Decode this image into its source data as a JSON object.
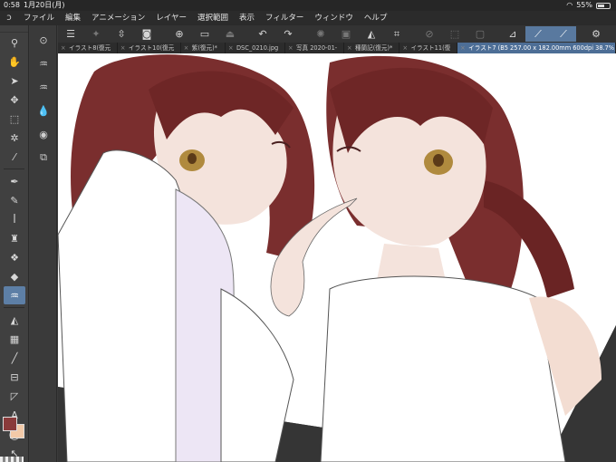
{
  "status": {
    "time": "0:58",
    "date": "1月20日(月)",
    "battery": "55%",
    "battery_level": 0.55
  },
  "menu": [
    "ファイル",
    "編集",
    "アニメーション",
    "レイヤー",
    "選択範囲",
    "表示",
    "フィルター",
    "ウィンドウ",
    "ヘルプ"
  ],
  "tabs": [
    {
      "label": "イラスト8(復元"
    },
    {
      "label": "イラスト10(復元"
    },
    {
      "label": "紫(復元)*"
    },
    {
      "label": "DSC_0210.jpg"
    },
    {
      "label": "写真 2020-01-"
    },
    {
      "label": "種蘭記(復元)*"
    },
    {
      "label": "イラスト11(復"
    },
    {
      "label": "イラスト7 (B5 257.00 x 182.00mm 600dpi 38.7%)",
      "active": true
    }
  ],
  "colors": {
    "main": "#8a3a3a",
    "sub": "#f2c9a8",
    "accent": "#5d7fa6",
    "hair": "#7a2e2e",
    "skin": "#f3e0d8",
    "eyes": "#b08a3e"
  }
}
